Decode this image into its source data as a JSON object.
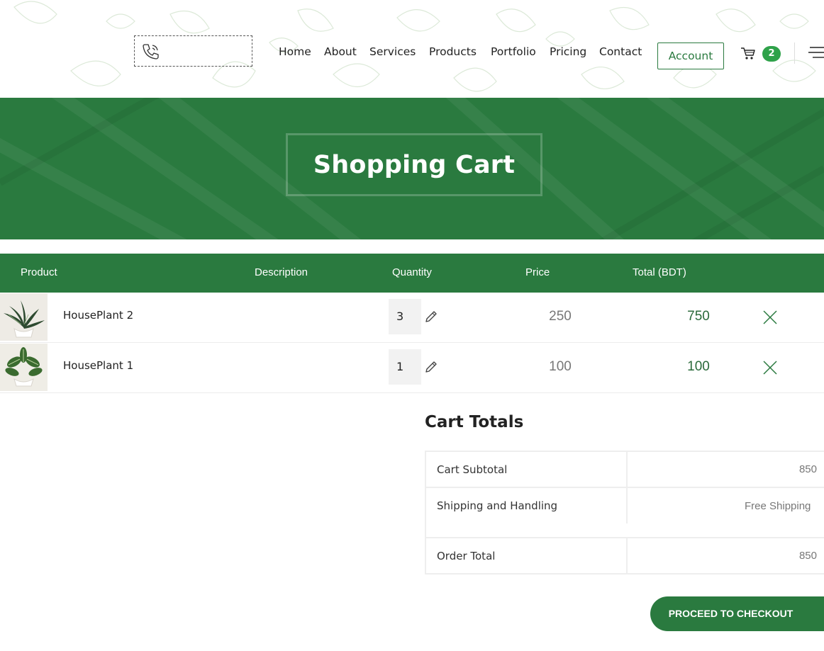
{
  "header": {
    "nav": [
      "Home",
      "About",
      "Services",
      "Products",
      "Portfolio",
      "Pricing",
      "Contact"
    ],
    "account_label": "Account",
    "cart_count": "2",
    "icons": [
      "phone-icon",
      "cart-icon",
      "menu-icon"
    ]
  },
  "banner": {
    "title": "Shopping Cart"
  },
  "cart": {
    "columns": {
      "product": "Product",
      "description": "Description",
      "quantity": "Quantity",
      "price": "Price",
      "total": "Total (BDT)"
    },
    "items": [
      {
        "name": "HousePlant 2",
        "quantity": "3",
        "price": "250",
        "total": "750"
      },
      {
        "name": "HousePlant 1",
        "quantity": "1",
        "price": "100",
        "total": "100"
      }
    ]
  },
  "totals": {
    "title": "Cart Totals",
    "subtotal_label": "Cart Subtotal",
    "subtotal_value": "850",
    "shipping_label": "Shipping and Handling",
    "shipping_value": "Free Shipping",
    "order_total_label": "Order Total",
    "order_total_value": "850"
  },
  "checkout_label": "PROCEED TO CHECKOUT",
  "colors": {
    "brand_green": "#2a7a3f",
    "badge_green": "#2fa24a"
  }
}
